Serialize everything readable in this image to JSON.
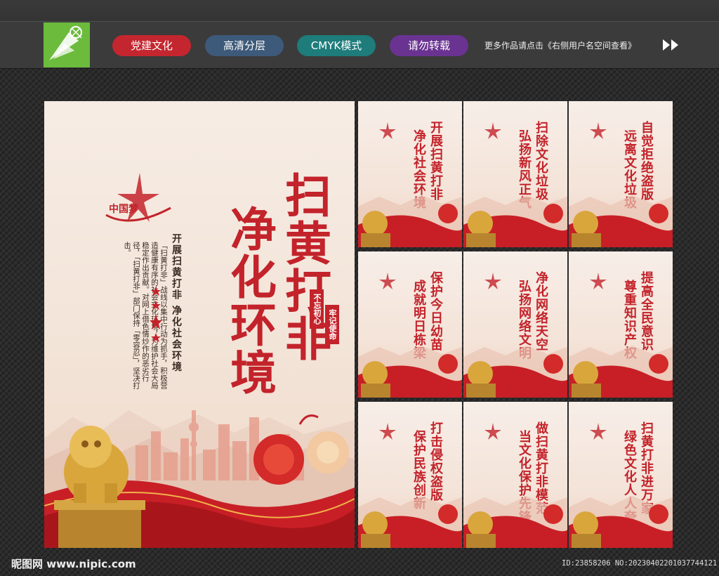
{
  "topbar": {
    "tags": [
      "党建文化",
      "高清分层",
      "CMYK模式",
      "请勿转载"
    ],
    "more_text": "更多作品请点击《右侧用户名空间查看》",
    "colors": {
      "red": "#c4262f",
      "blue": "#3d5a7a",
      "teal": "#1e7c7b",
      "purple": "#6a3391",
      "logo": "#6cbb3c"
    }
  },
  "main_poster": {
    "title_line1": "扫黄打非",
    "title_line2": "净化环境",
    "subtitle": "开展扫黄打非  净化社会环境",
    "body": "「扫黄打非」战线以集中行动为抓手，积极营造健康有序的社会文化环境，为维护社会大局稳定作出贡献。对网上借色情炒作的恶劣行径，「扫黄打非」部门保持「零容忍」，坚决打击。",
    "seal_left": "不忘初心",
    "seal_right": "牢记使命",
    "logo_text": "中国梦"
  },
  "cards": [
    {
      "line1": "开展扫黄打非",
      "line2": "净化社会环境"
    },
    {
      "line1": "扫除文化垃圾",
      "line2": "弘扬新风正气"
    },
    {
      "line1": "自觉拒绝盗版",
      "line2": "远离文化垃圾"
    },
    {
      "line1": "保护今日幼苗",
      "line2": "成就明日栋梁"
    },
    {
      "line1": "净化网络天空",
      "line2": "弘扬网络文明"
    },
    {
      "line1": "提高全民意识",
      "line2": "尊重知识产权"
    },
    {
      "line1": "打击侵权盗版",
      "line2": "保护民族创新"
    },
    {
      "line1": "做扫黄打非模范",
      "line2": "当文化保护先锋"
    },
    {
      "line1": "扫黄打非进万家",
      "line2": "绿色文化人人夸"
    }
  ],
  "footer": {
    "site": "昵图网 www.nipic.com",
    "id_text": "ID:23858206 NO:20230402201037744121"
  }
}
